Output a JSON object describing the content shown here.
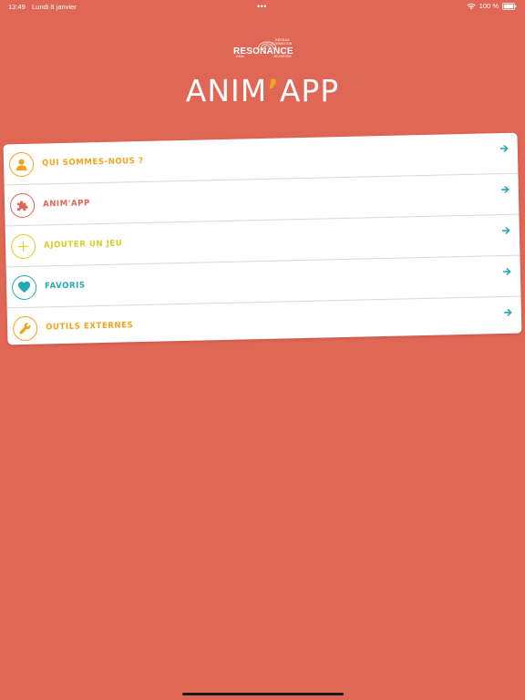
{
  "status_bar": {
    "time": "13:49",
    "date": "Lundi 8 janvier",
    "multitask_dots": "•••",
    "battery_text": "100 %"
  },
  "logo": {
    "line1": "RÉSEAU",
    "line2": "FORMATION",
    "main": "RESONANCE",
    "line3": "JEUNESSE",
    "line4": "ASBL"
  },
  "app": {
    "title_part1": "ANIM",
    "title_apostrophe": "’",
    "title_part2": "APP"
  },
  "menu": {
    "items": [
      {
        "label": "QUI SOMMES-NOUS ?",
        "icon": "person-icon",
        "color": "#f3a21d"
      },
      {
        "label": "ANIM'APP",
        "icon": "puzzle-icon",
        "color": "#e06655"
      },
      {
        "label": "AJOUTER UN JEU",
        "icon": "plus-icon",
        "color": "#d9ce1f"
      },
      {
        "label": "FAVORIS",
        "icon": "heart-icon",
        "color": "#22a9b4"
      },
      {
        "label": "OUTILS EXTERNES",
        "icon": "wrench-icon",
        "color": "#f3a21d"
      }
    ],
    "arrow_color": "#22a9b4",
    "arrow_icon": "arrow-right-icon"
  },
  "colors": {
    "background": "#e06655",
    "white": "#ffffff"
  }
}
